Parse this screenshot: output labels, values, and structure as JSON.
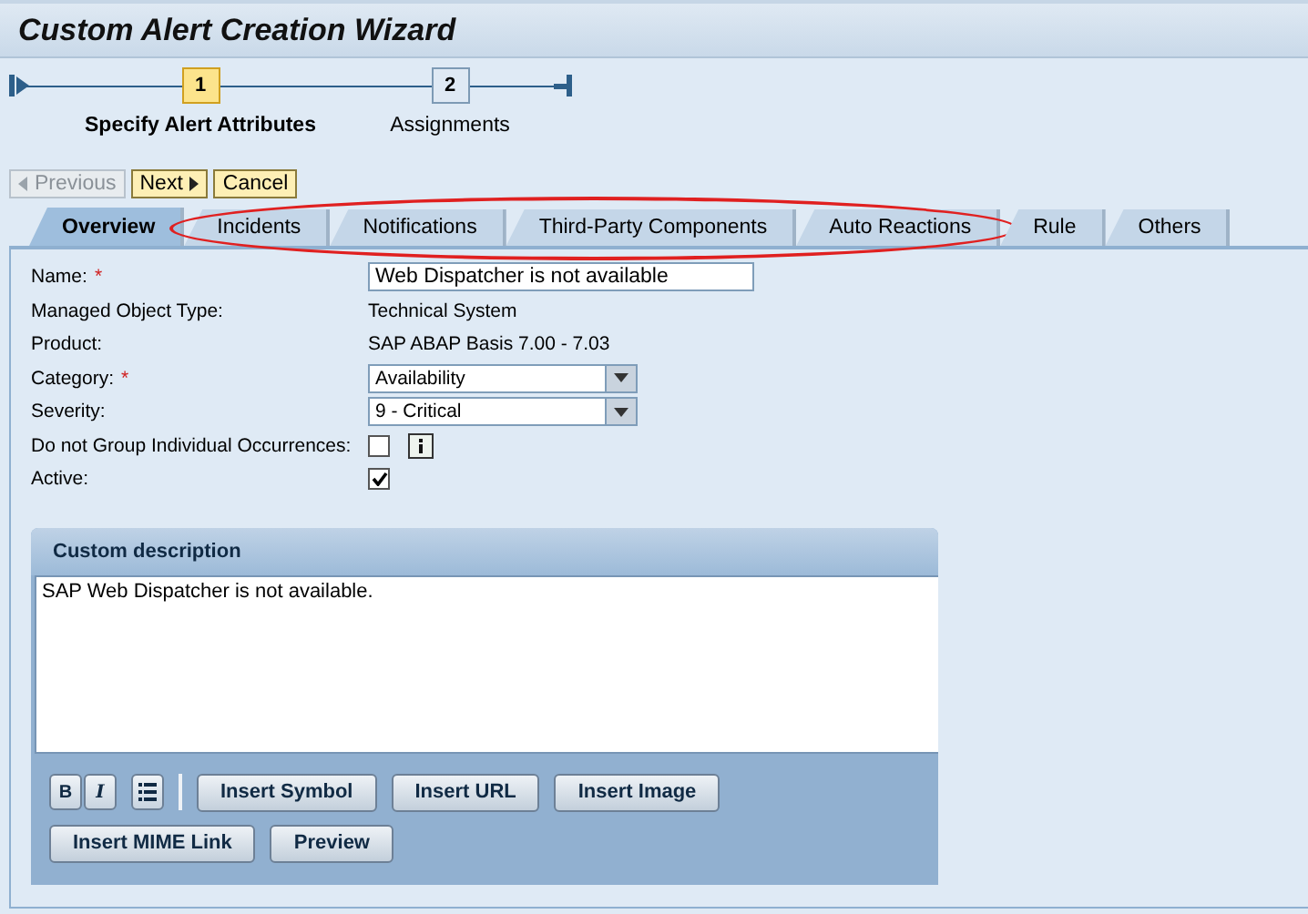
{
  "window": {
    "title": "Custom Alert Creation Wizard"
  },
  "steps": [
    {
      "number": "1",
      "label": "Specify Alert Attributes",
      "selected": true
    },
    {
      "number": "2",
      "label": "Assignments",
      "selected": false
    }
  ],
  "nav_buttons": [
    {
      "kind": "previous",
      "label": "Previous",
      "disabled": true
    },
    {
      "kind": "next",
      "label": "Next",
      "disabled": false
    },
    {
      "kind": "plain",
      "label": "Cancel",
      "disabled": false
    }
  ],
  "tabs": [
    {
      "kind": "tab",
      "label": "Overview",
      "selected": true
    },
    {
      "kind": "circled_group",
      "children": [
        {
          "kind": "tab",
          "label": "Incidents",
          "selected": false
        },
        {
          "kind": "tab",
          "label": "Notifications",
          "selected": false
        },
        {
          "kind": "tab",
          "label": "Third-Party Components",
          "selected": false
        },
        {
          "kind": "tab",
          "label": "Auto Reactions",
          "selected": false
        }
      ]
    },
    {
      "kind": "tab",
      "label": "Rule",
      "selected": false
    },
    {
      "kind": "tab",
      "label": "Others",
      "selected": false
    }
  ],
  "form": [
    {
      "kind": "input",
      "label": "Name:",
      "required_mark": "*",
      "value": "Web Dispatcher is not available"
    },
    {
      "kind": "text",
      "label": "Managed Object Type:",
      "value": "Technical System"
    },
    {
      "kind": "text",
      "label": "Product:",
      "value": "SAP ABAP Basis 7.00 - 7.03"
    },
    {
      "kind": "dropdown",
      "label": "Category:",
      "required_mark": "*",
      "value": "Availability"
    },
    {
      "kind": "dropdown",
      "label": "Severity:",
      "value": "9 - Critical"
    },
    {
      "kind": "checkbox",
      "label": "Do not Group Individual Occurrences:",
      "checked": false,
      "info": true
    },
    {
      "kind": "checkbox",
      "label": "Active:",
      "checked": true,
      "info": false
    }
  ],
  "description": {
    "title": "Custom description",
    "text": "SAP Web Dispatcher is not available.",
    "format_buttons": [
      {
        "kind": "bold",
        "label": "B"
      },
      {
        "kind": "italic",
        "label": "I"
      },
      {
        "kind": "list"
      }
    ],
    "buttons": [
      "Insert Symbol",
      "Insert URL",
      "Insert Image",
      "Insert MIME Link",
      "Preview"
    ]
  }
}
